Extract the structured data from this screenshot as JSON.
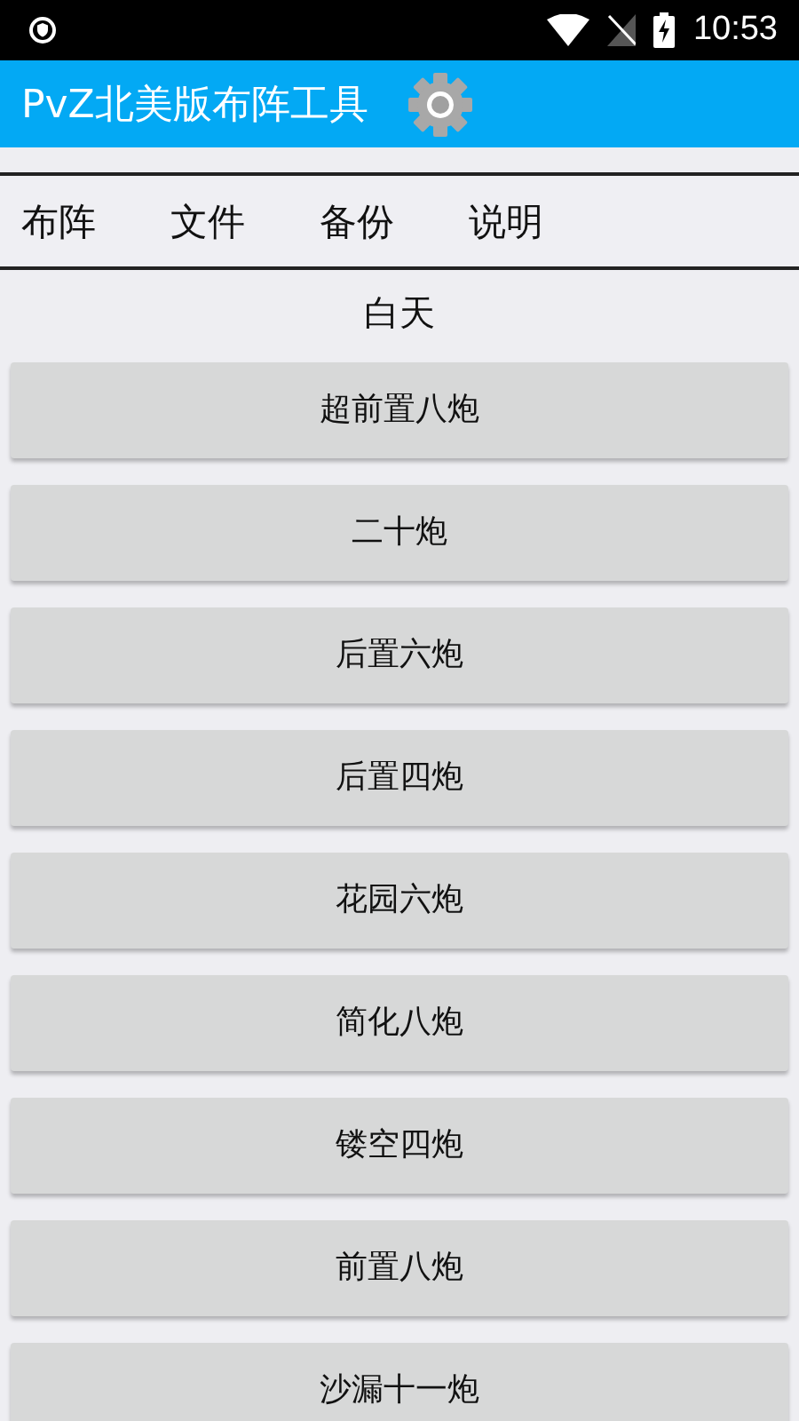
{
  "status_bar": {
    "time": "10:53"
  },
  "app_bar": {
    "title": "PvZ北美版布阵工具"
  },
  "menu": [
    {
      "label": "布阵"
    },
    {
      "label": "文件"
    },
    {
      "label": "备份"
    },
    {
      "label": "说明"
    }
  ],
  "section": {
    "title": "白天"
  },
  "layouts": [
    {
      "label": "超前置八炮"
    },
    {
      "label": "二十炮"
    },
    {
      "label": "后置六炮"
    },
    {
      "label": "后置四炮"
    },
    {
      "label": "花园六炮"
    },
    {
      "label": "简化八炮"
    },
    {
      "label": "镂空四炮"
    },
    {
      "label": "前置八炮"
    },
    {
      "label": "沙漏十一炮"
    }
  ]
}
